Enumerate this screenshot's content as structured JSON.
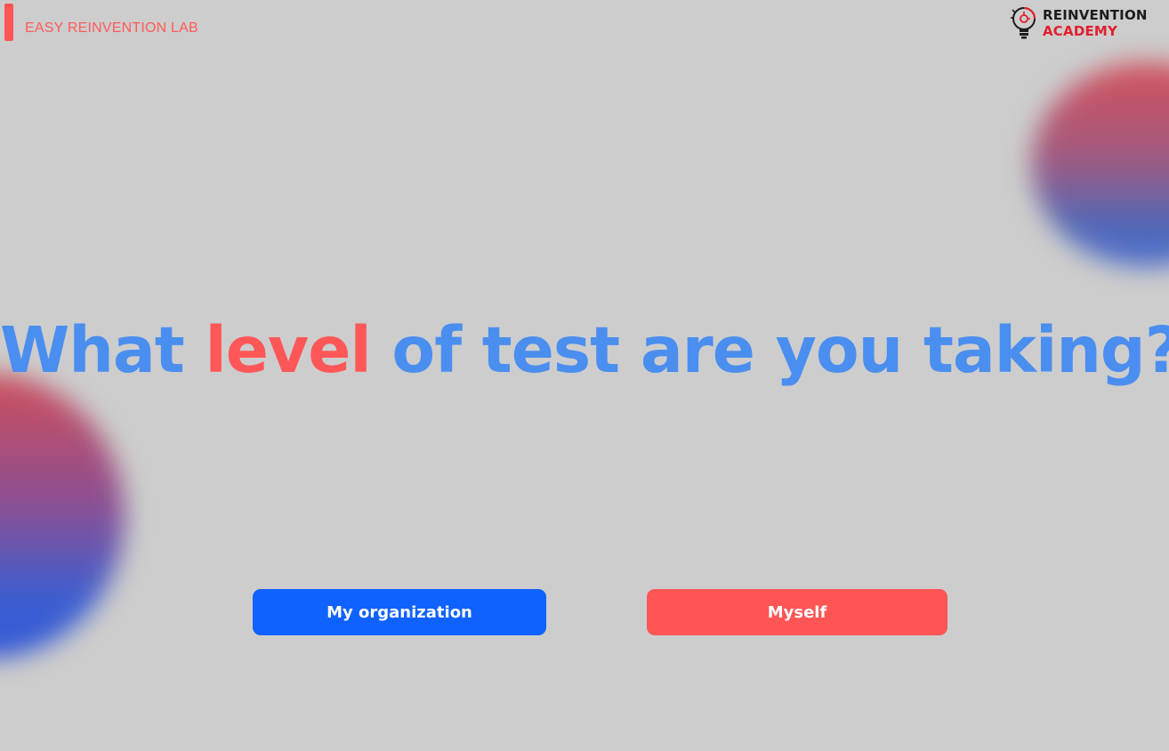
{
  "header": {
    "brand_label": "EASY REINVENTION LAB",
    "logo": {
      "line1": "REINVENTION",
      "line2": "ACADEMY",
      "icon": "lightbulb-icon"
    }
  },
  "main": {
    "headline": {
      "before": "What ",
      "highlight": "level",
      "after": " of test are you taking?"
    },
    "options": [
      {
        "label": "My organization"
      },
      {
        "label": "Myself"
      }
    ]
  },
  "colors": {
    "accent_blue": "#4a8ef0",
    "accent_red": "#ff5757",
    "button_blue": "#0f62fe",
    "button_red": "#ff5555",
    "background": "#cdcdcd"
  }
}
